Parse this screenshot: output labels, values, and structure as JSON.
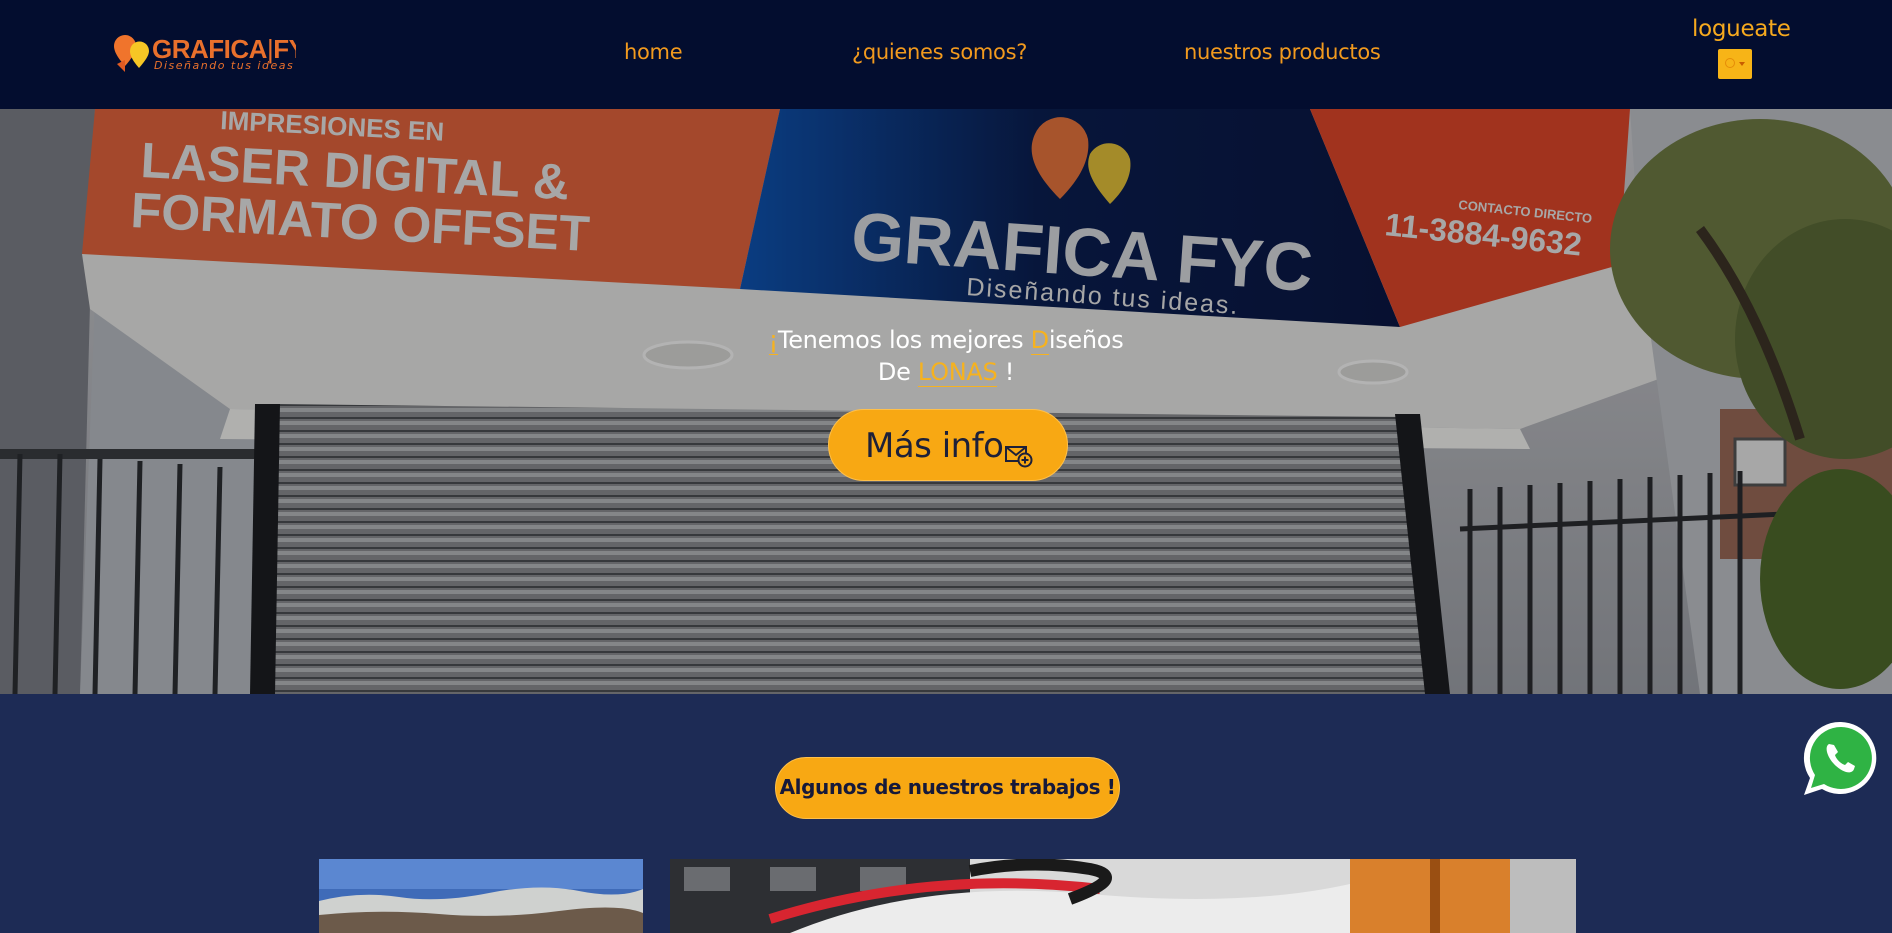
{
  "brand": {
    "name_left": "GRAFICA",
    "name_sep": "|",
    "name_right": "FYC",
    "tagline": "Diseñando tus ideas"
  },
  "nav": {
    "home": "home",
    "about": "¿quienes somos?",
    "products": "nuestros productos"
  },
  "auth": {
    "login_label": "logueate"
  },
  "hero": {
    "line1_a": "¡",
    "line1_b": "Tenemos los mejores ",
    "line1_c": "D",
    "line1_d": "iseños",
    "line2_a": "De ",
    "line2_b": "LONAS",
    "line2_c": " !",
    "button_label": "Más info",
    "sign": {
      "left_line1": "IMPRESIONES EN",
      "left_line2": "LASER DIGITAL &",
      "left_line3": "FORMATO OFFSET",
      "center_name": "GRAFICA FYC",
      "center_tag": "Diseñando tus ideas.",
      "right_small": "CONTACTO DIRECTO",
      "right_phone": "11-3884-9632"
    }
  },
  "works": {
    "title": "Algunos de nuestros trabajos !"
  },
  "colors": {
    "nav_bg": "#030d2f",
    "section_bg": "#1d2b55",
    "accent": "#f8a813",
    "nav_text": "#f29a1e"
  },
  "icons": [
    "user-icon",
    "chevron-down-icon",
    "mail-plus-icon",
    "whatsapp-icon"
  ]
}
